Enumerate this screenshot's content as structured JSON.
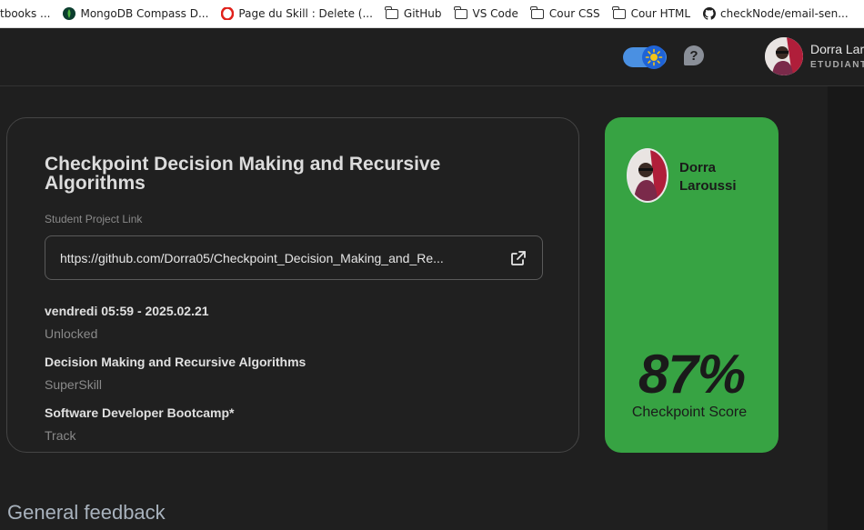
{
  "bookmarks": [
    {
      "label": "tbooks ...",
      "icon": "bookmark-icon"
    },
    {
      "label": "MongoDB Compass D...",
      "icon": "mongodb-leaf-icon"
    },
    {
      "label": "Page du Skill : Delete (...",
      "icon": "opera-icon"
    },
    {
      "label": "GitHub",
      "icon": "folder-icon"
    },
    {
      "label": "VS Code",
      "icon": "folder-icon"
    },
    {
      "label": "Cour CSS",
      "icon": "folder-icon"
    },
    {
      "label": "Cour HTML",
      "icon": "folder-icon"
    },
    {
      "label": "checkNode/email-sen...",
      "icon": "github-icon"
    }
  ],
  "header": {
    "theme_toggle": {
      "state": "on",
      "icon": "sun-icon",
      "accent": "#4a90e2"
    },
    "help_label": "?",
    "user": {
      "name": "Dorra Lar",
      "role": "ETUDIANT"
    }
  },
  "project": {
    "title": "Checkpoint Decision Making and Recursive Algorithms",
    "link_label": "Student Project Link",
    "link_url": "https://github.com/Dorra05/Checkpoint_Decision_Making_and_Re...",
    "date": "vendredi 05:59 - 2025.02.21",
    "status": "Unlocked",
    "skill": "Decision Making and Recursive Algorithms",
    "skill_type": "SuperSkill",
    "track": "Software Developer Bootcamp*",
    "track_label": "Track"
  },
  "score": {
    "student_name": "Dorra Laroussi",
    "percent": "87%",
    "label": "Checkpoint Score",
    "color": "#37a343"
  },
  "feedback": {
    "heading": "General feedback"
  }
}
